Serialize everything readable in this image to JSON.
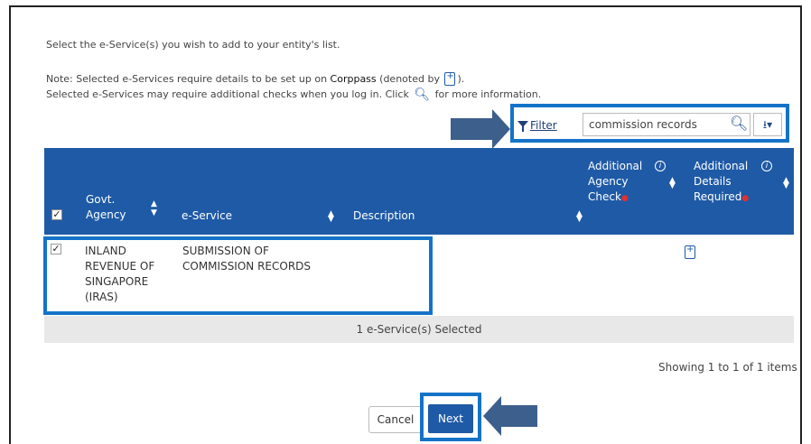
{
  "intro": "Select the e-Service(s) you wish to add to your entity's list.",
  "note": {
    "line1_prefix": "Note: Selected e-Services require details to be set up on",
    "corppass": "Corppass",
    "line1_suffix": "(denoted by",
    "line1_end": ").",
    "line2_prefix": "Selected e-Services may require additional checks when you log in. Click",
    "line2_suffix": "for more information."
  },
  "toolbar": {
    "filter_label": "Filter",
    "search_value": "commission records"
  },
  "table": {
    "headers": {
      "agency": "Govt. Agency",
      "eservice": "e-Service",
      "description": "Description",
      "additional_check": "Additional Agency Check",
      "additional_details": "Additional Details Required"
    },
    "rows": [
      {
        "agency": "INLAND REVENUE OF SINGAPORE (IRAS)",
        "eservice": "SUBMISSION OF COMMISSION RECORDS",
        "description": "",
        "checked": true
      }
    ],
    "selected_summary": "1 e-Service(s) Selected",
    "showing": "Showing 1 to 1 of 1 items"
  },
  "buttons": {
    "cancel": "Cancel",
    "next": "Next"
  },
  "colors": {
    "header_blue": "#1f5aa6",
    "highlight_blue": "#1473c8",
    "arrow": "#3d5f8c"
  }
}
